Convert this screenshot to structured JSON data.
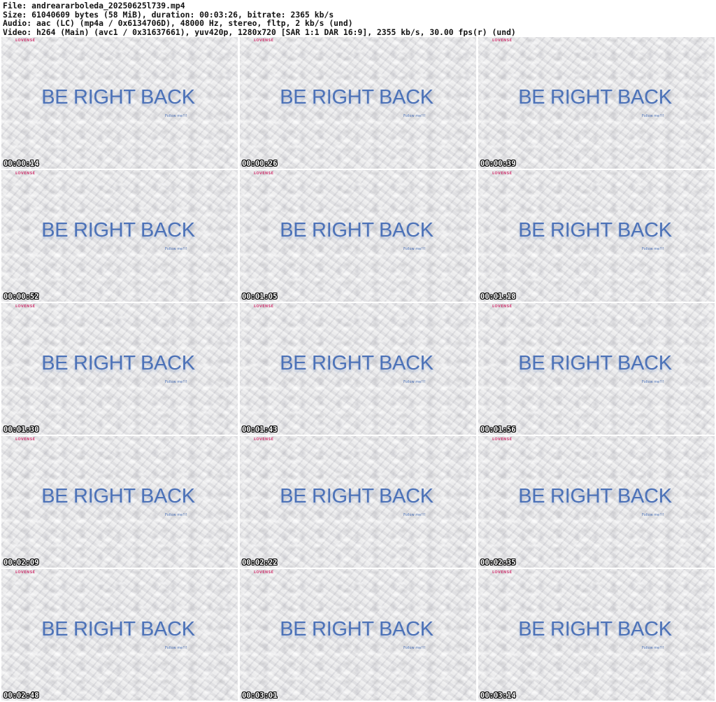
{
  "header": {
    "file_line": "File: andreararboleda_20250625l739.mp4",
    "size_line": "Size: 61040609 bytes (58 MiB), duration: 00:03:26, bitrate: 2365 kb/s",
    "audio_line": "Audio: aac (LC) (mp4a / 0x6134706D), 48000 Hz, stereo, fltp, 2 kb/s (und)",
    "video_line": "Video: h264 (Main) (avc1 / 0x31637661), yuv420p, 1280x720 [SAR 1:1 DAR 16:9], 2355 kb/s, 30.00 fps(r) (und)"
  },
  "frame_content": {
    "logo_text": "LOVENSE",
    "main_text": "BE RIGHT BACK",
    "follow_text": "Follow me!!!",
    "text_color": "#4c72b8",
    "logo_color": "#d2447a"
  },
  "thumbnails": [
    {
      "timestamp": "00:00:14"
    },
    {
      "timestamp": "00:00:26"
    },
    {
      "timestamp": "00:00:39"
    },
    {
      "timestamp": "00:00:52"
    },
    {
      "timestamp": "00:01:05"
    },
    {
      "timestamp": "00:01:18"
    },
    {
      "timestamp": "00:01:30"
    },
    {
      "timestamp": "00:01:43"
    },
    {
      "timestamp": "00:01:56"
    },
    {
      "timestamp": "00:02:09"
    },
    {
      "timestamp": "00:02:22"
    },
    {
      "timestamp": "00:02:35"
    },
    {
      "timestamp": "00:02:48"
    },
    {
      "timestamp": "00:03:01"
    },
    {
      "timestamp": "00:03:14"
    }
  ]
}
